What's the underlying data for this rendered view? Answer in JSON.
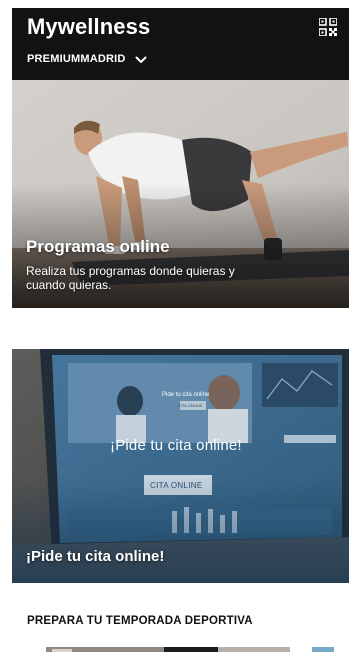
{
  "header": {
    "app_title": "Mywellness",
    "club_name": "PREMIUMMADRID",
    "qr_icon": "qr-code-icon",
    "dropdown_icon": "chevron-down-icon"
  },
  "cards": {
    "programs": {
      "title": "Programas online",
      "description_line1": "Realiza tus programas donde quieras y",
      "description_line2": "cuando quieras."
    },
    "cita": {
      "title": "¡Pide tu cita online!",
      "screen_heading": "¡Pide tu cita online!",
      "screen_button": "CITA ONLINE",
      "screen_small_heading": "Pide tu cita online",
      "screen_small_button": "CITA ONLINE"
    }
  },
  "section": {
    "title": "PREPARA TU TEMPORADA DEPORTIVA"
  },
  "colors": {
    "header_bg": "#121212",
    "text_on_dark": "#ffffff",
    "cita_tint": "#1f4e73"
  }
}
